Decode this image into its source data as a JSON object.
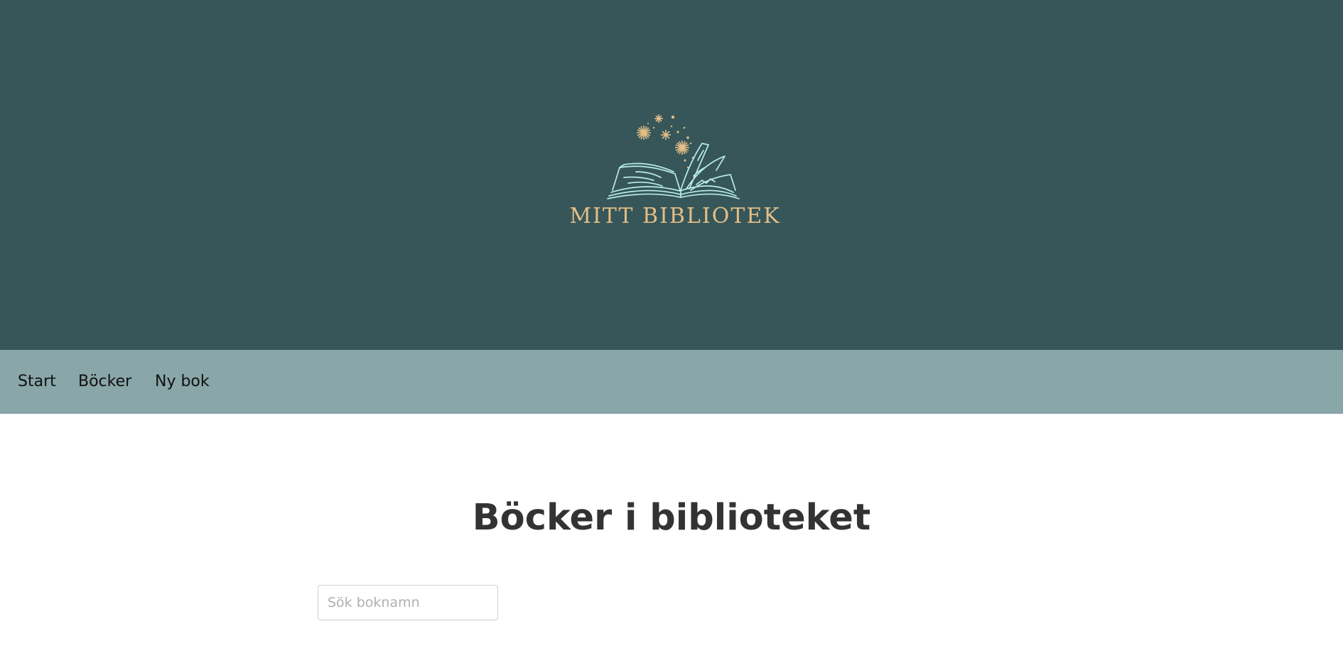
{
  "header": {
    "logo_text": "MITT BIBLIOTEK",
    "background_color": "#365659",
    "logo_text_color": "#e3be86",
    "logo_line_color": "#b9ecea",
    "logo_icon": "open-book-with-sparkles-icon"
  },
  "nav": {
    "background_color": "#89a6a8",
    "items": [
      {
        "label": "Start"
      },
      {
        "label": "Böcker"
      },
      {
        "label": "Ny bok"
      }
    ]
  },
  "main": {
    "title": "Böcker i biblioteket",
    "search": {
      "placeholder": "Sök boknamn",
      "value": ""
    }
  }
}
